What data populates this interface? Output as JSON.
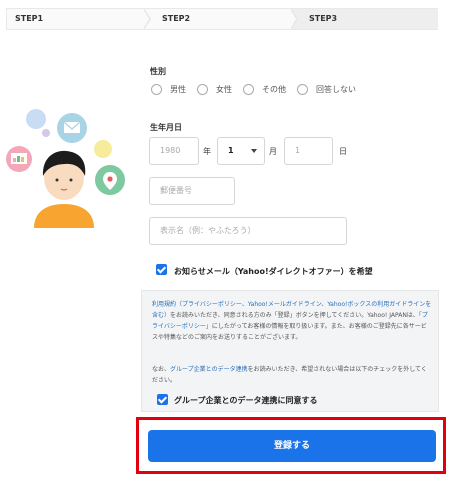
{
  "steps": [
    {
      "label": "STEP1"
    },
    {
      "label": "STEP2"
    },
    {
      "label": "STEP3"
    }
  ],
  "gender": {
    "label": "性別",
    "options": [
      "男性",
      "女性",
      "その他",
      "回答しない"
    ]
  },
  "birthdate": {
    "label": "生年月日",
    "year_placeholder": "1980",
    "year_unit": "年",
    "month_value": "1",
    "month_unit": "月",
    "day_placeholder": "1",
    "day_unit": "日"
  },
  "postal": {
    "placeholder": "郵便番号"
  },
  "display_name": {
    "placeholder": "表示名（例：やふたろう）"
  },
  "newsletter": {
    "label": "お知らせメール（Yahoo!ダイレクトオファー）を希望",
    "checked": true
  },
  "terms": {
    "p1_link1": "利用規約（プライバシーポリシー、Yahoo!メールガイドライン、Yahoo!ボックスの利用ガイドラインを含む）",
    "p1_text1": "をお読みいただき、同意される方のみ「登録」ボタンを押してください。Yahoo! JAPANは、「",
    "p1_link2": "プライバシーポリシー",
    "p1_text2": "」にしたがってお客様の情報を取り扱います。また、お客様のご登録先に各サービスや特集などのご案内をお送りすることがございます。",
    "p2_text1": "なお、",
    "p2_link": "グループ企業とのデータ連携",
    "p2_text2": "をお読みいただき、希望されない場合は以下のチェックを外してください。",
    "group_label": "グループ企業とのデータ連携に同意する",
    "group_checked": true
  },
  "submit": {
    "label": "登録する"
  },
  "colors": {
    "accent": "#1a73e8",
    "highlight": "#e00010"
  }
}
